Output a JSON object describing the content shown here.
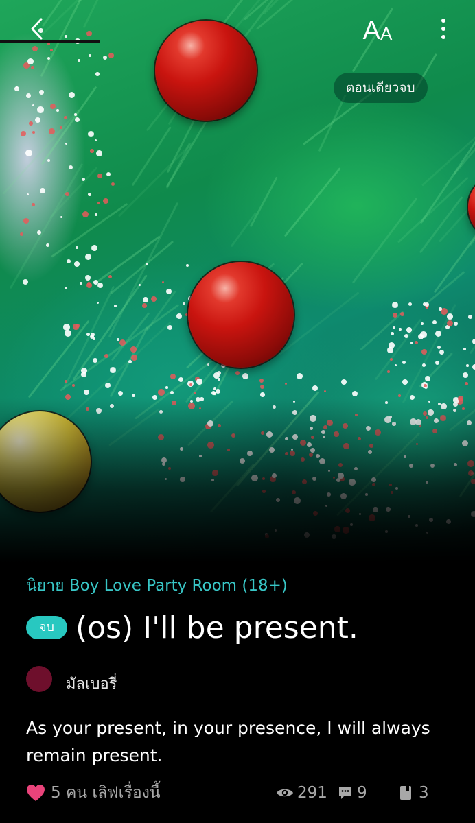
{
  "header": {
    "font_button_big": "A",
    "font_button_small": "A",
    "oneshot_badge": "ตอนเดียวจบ",
    "reading_progress": 0.21
  },
  "story": {
    "category": "นิยาย Boy Love Party Room  (18+)",
    "status_badge": "จบ",
    "title": "(os) I'll be present.",
    "author": "มัลเบอรี่",
    "description": "As your present, in your presence, I will always remain present."
  },
  "stats": {
    "likes_text": "5 คน เลิฟเรื่องนี้",
    "views": "291",
    "comments": "9",
    "chapters": "3"
  },
  "colors": {
    "accent": "#38c6c6",
    "badge": "#28c8c0",
    "heart": "#e9437a",
    "avatar": "#6e0f2c"
  }
}
